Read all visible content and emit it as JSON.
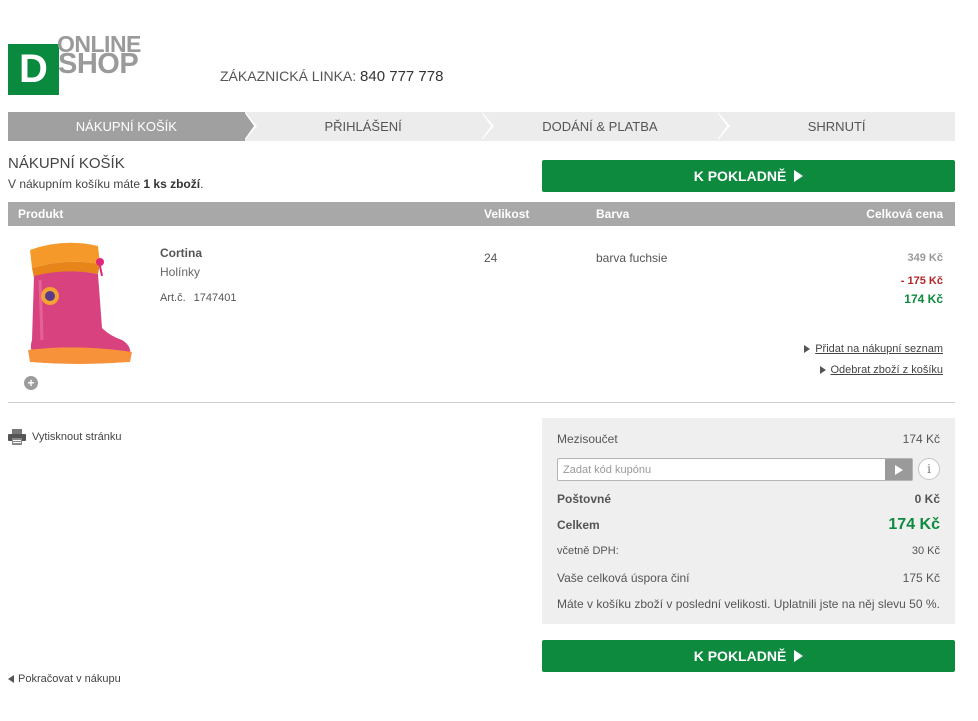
{
  "header": {
    "logo_letter": "D",
    "logo_online": "ONLINE",
    "logo_shop": "SHOP",
    "hotline_label": "ZÁKAZNICKÁ LINKA:",
    "hotline_number": "840 777 778"
  },
  "steps": [
    {
      "label": "NÁKUPNÍ KOŠÍK",
      "active": true
    },
    {
      "label": "PŘIHLÁŠENÍ",
      "active": false
    },
    {
      "label": "DODÁNÍ & PLATBA",
      "active": false
    },
    {
      "label": "SHRNUTÍ",
      "active": false
    }
  ],
  "cart": {
    "title": "NÁKUPNÍ KOŠÍK",
    "info_prefix": "V nákupním košíku máte ",
    "info_count": "1 ks zboží",
    "info_suffix": ".",
    "checkout_label": "K POKLADNĚ"
  },
  "table": {
    "headers": {
      "product": "Produkt",
      "size": "Velikost",
      "color": "Barva",
      "total": "Celková cena"
    }
  },
  "item": {
    "name": "Cortina",
    "type": "Holínky",
    "art_label": "Art.č.",
    "art_number": "1747401",
    "size": "24",
    "color": "barva fuchsie",
    "price_old": "349 Kč",
    "price_discount": "- 175 Kč",
    "price_final": "174 Kč",
    "add_wishlist": "Přidat na nákupní seznam",
    "remove": "Odebrat zboží z košíku",
    "zoom_symbol": "+"
  },
  "print_label": "Vytisknout stránku",
  "summary": {
    "subtotal_label": "Mezisoučet",
    "subtotal_value": "174 Kč",
    "coupon_placeholder": "Zadat kód kupónu",
    "info_symbol": "i",
    "shipping_label": "Poštovné",
    "shipping_value": "0 Kč",
    "total_label": "Celkem",
    "total_value": "174 Kč",
    "vat_label": "včetně DPH:",
    "vat_value": "30 Kč",
    "savings_label": "Vaše celková úspora činí",
    "savings_value": "175 Kč",
    "note": "Máte v košíku zboží v poslední velikosti. Uplatnili jste na něj slevu 50 %."
  },
  "continue_label": "Pokračovat v nákupu",
  "colors": {
    "brand_green": "#0d8a3e",
    "discount_red": "#b0262a",
    "step_active": "#a0a0a0"
  }
}
